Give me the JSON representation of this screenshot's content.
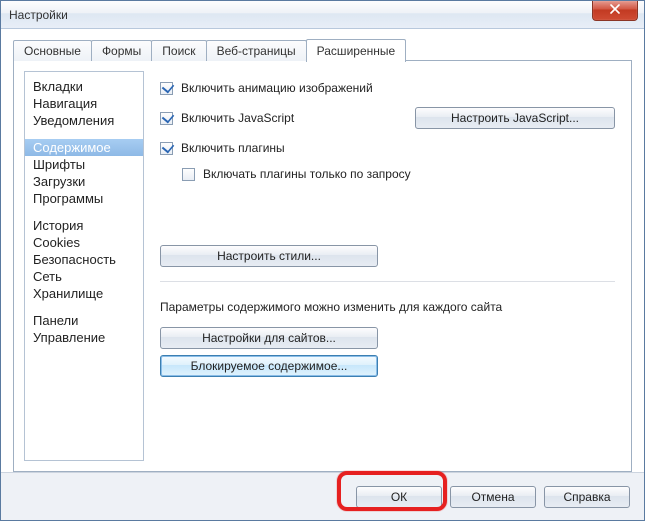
{
  "window": {
    "title": "Настройки"
  },
  "tabs": [
    {
      "label": "Основные"
    },
    {
      "label": "Формы"
    },
    {
      "label": "Поиск"
    },
    {
      "label": "Веб-страницы"
    },
    {
      "label": "Расширенные",
      "active": true
    }
  ],
  "sidebar": {
    "groups": [
      [
        "Вкладки",
        "Навигация",
        "Уведомления"
      ],
      [
        "Содержимое",
        "Шрифты",
        "Загрузки",
        "Программы"
      ],
      [
        "История",
        "Cookies",
        "Безопасность",
        "Сеть",
        "Хранилище"
      ],
      [
        "Панели",
        "Управление"
      ]
    ],
    "selected": "Содержимое"
  },
  "content": {
    "enable_image_anim": {
      "label": "Включить анимацию изображений",
      "checked": true
    },
    "enable_js": {
      "label": "Включить JavaScript",
      "checked": true
    },
    "configure_js": "Настроить JavaScript...",
    "enable_plugins": {
      "label": "Включить плагины",
      "checked": true
    },
    "enable_plugins_on_demand": {
      "label": "Включать плагины только по запросу",
      "checked": false
    },
    "configure_styles": "Настроить стили...",
    "site_params_desc": "Параметры содержимого можно изменить для каждого сайта",
    "site_settings": "Настройки для сайтов...",
    "blocked_content": "Блокируемое содержимое..."
  },
  "footer": {
    "ok": "ОК",
    "cancel": "Отмена",
    "help": "Справка"
  }
}
